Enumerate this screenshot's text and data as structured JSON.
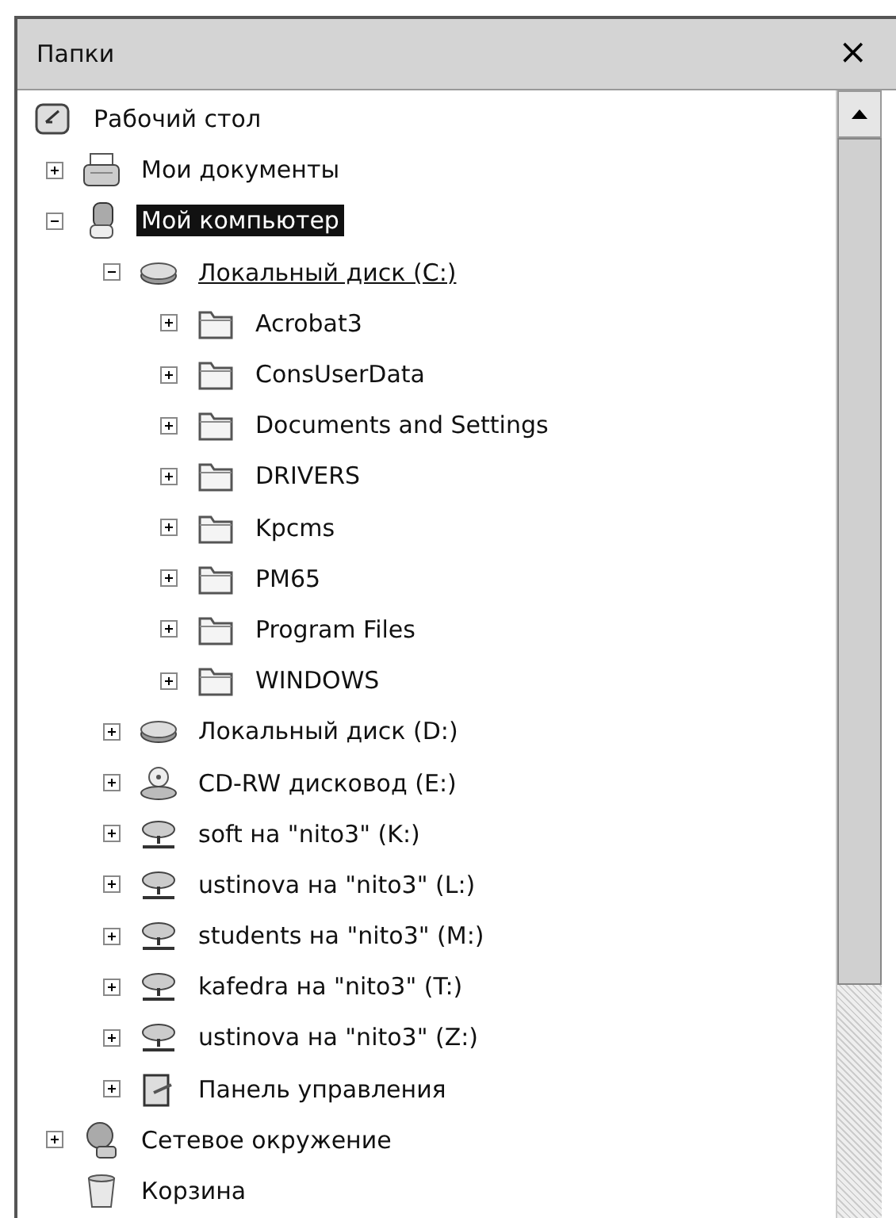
{
  "panel": {
    "title": "Папки",
    "close": "×"
  },
  "tree": [
    {
      "label": "Рабочий стол",
      "kind": "desktop",
      "selected": false,
      "children": [
        {
          "label": "Мои документы",
          "kind": "documents",
          "expanded": false,
          "selected": false
        },
        {
          "label": "Мой компьютер",
          "kind": "computer",
          "expanded": true,
          "selected": true,
          "children": [
            {
              "label": "Локальный диск (C:)",
              "kind": "drive",
              "expanded": true,
              "selected": false,
              "hot": true,
              "children": [
                {
                  "label": "Acrobat3",
                  "kind": "folder",
                  "expanded": false,
                  "selected": false
                },
                {
                  "label": "ConsUserData",
                  "kind": "folder",
                  "expanded": false,
                  "selected": false
                },
                {
                  "label": "Documents and Settings",
                  "kind": "folder",
                  "expanded": false,
                  "selected": false
                },
                {
                  "label": "DRIVERS",
                  "kind": "folder",
                  "expanded": false,
                  "selected": false
                },
                {
                  "label": "Kpcms",
                  "kind": "folder",
                  "expanded": false,
                  "selected": false
                },
                {
                  "label": "PM65",
                  "kind": "folder",
                  "expanded": false,
                  "selected": false
                },
                {
                  "label": "Program Files",
                  "kind": "folder",
                  "expanded": false,
                  "selected": false
                },
                {
                  "label": "WINDOWS",
                  "kind": "folder",
                  "expanded": false,
                  "selected": false
                }
              ]
            },
            {
              "label": "Локальный диск (D:)",
              "kind": "drive",
              "expanded": false,
              "selected": false
            },
            {
              "label": "CD-RW дисковод (E:)",
              "kind": "cdrom",
              "expanded": false,
              "selected": false
            },
            {
              "label": "soft на \"nito3\" (K:)",
              "kind": "netdrive",
              "expanded": false,
              "selected": false
            },
            {
              "label": "ustinova на \"nito3\" (L:)",
              "kind": "netdrive",
              "expanded": false,
              "selected": false
            },
            {
              "label": "students на \"nito3\" (M:)",
              "kind": "netdrive",
              "expanded": false,
              "selected": false
            },
            {
              "label": "kafedra на \"nito3\" (T:)",
              "kind": "netdrive",
              "expanded": false,
              "selected": false
            },
            {
              "label": "ustinova на \"nito3\" (Z:)",
              "kind": "netdrive",
              "expanded": false,
              "selected": false
            },
            {
              "label": "Панель управления",
              "kind": "controlpanel",
              "expanded": false,
              "selected": false
            }
          ]
        },
        {
          "label": "Сетевое окружение",
          "kind": "network",
          "expanded": false,
          "selected": false
        },
        {
          "label": "Корзина",
          "kind": "recycle",
          "selected": false
        }
      ]
    }
  ]
}
